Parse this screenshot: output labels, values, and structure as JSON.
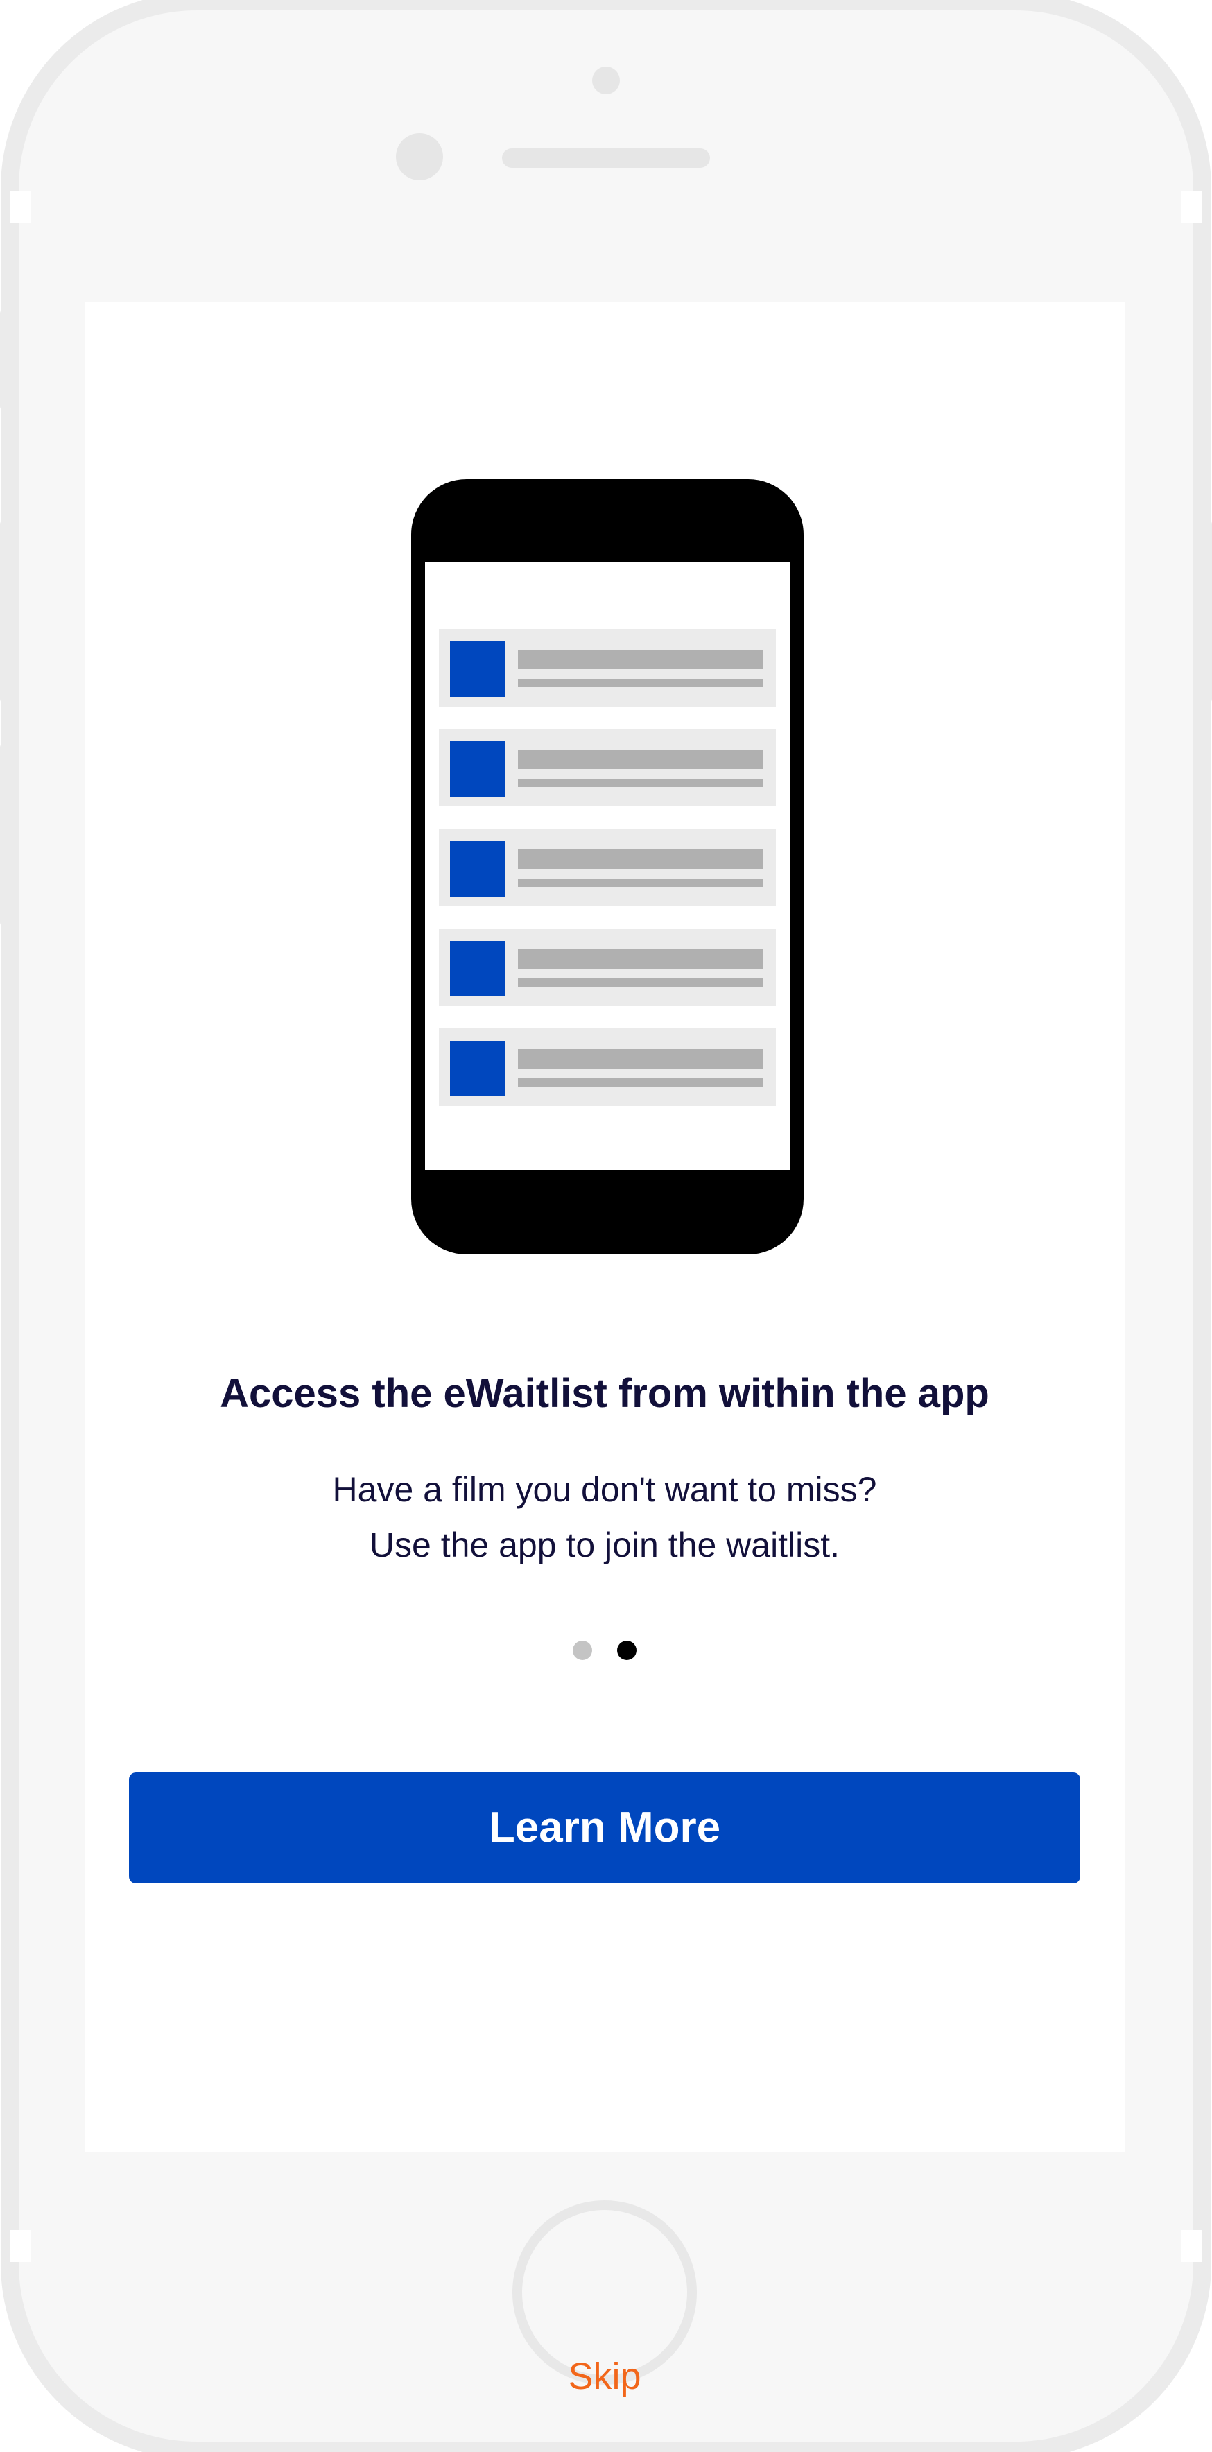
{
  "onboarding": {
    "headline": "Access the eWaitlist from within the app",
    "subtext_lines": [
      "Have a film you don't want to miss?",
      "Use the app to join the waitlist."
    ],
    "pagination": {
      "total": 2,
      "current": 2
    },
    "primary_button_label": "Learn More",
    "skip_label": "Skip"
  },
  "colors": {
    "accent": "#0047be",
    "skip": "#f2661a",
    "headline": "#12103a",
    "dot_inactive": "#c4c4c4",
    "dot_active": "#000000"
  },
  "icons": {
    "illustration": "phone-list-illustration",
    "list_item_thumbnail": "blue-square-thumbnail"
  }
}
